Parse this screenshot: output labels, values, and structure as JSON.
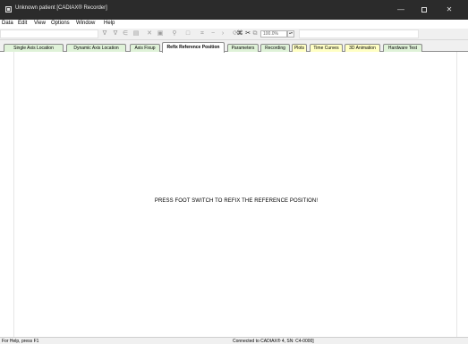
{
  "window": {
    "title": "Unknown patient [CADIAX® Recorder]",
    "minimize_glyph": "—",
    "close_glyph": "✕"
  },
  "menu": [
    "Data",
    "Edit",
    "View",
    "Options",
    "Window",
    "Help"
  ],
  "toolbar": {
    "zoom_value": "100.0%",
    "spin_glyph": "▴▾",
    "icons": [
      {
        "name": "filter-icon",
        "glyph": "∇"
      },
      {
        "name": "curve-select-icon",
        "glyph": "∇"
      },
      {
        "name": "transfer-icon",
        "glyph": "∈"
      },
      {
        "name": "print-icon",
        "glyph": "▤"
      },
      {
        "name": "delete-icon",
        "glyph": "✕"
      },
      {
        "name": "save-icon",
        "glyph": "▣"
      },
      {
        "name": "search-icon",
        "glyph": "⚲"
      },
      {
        "name": "copy-icon",
        "glyph": "□"
      },
      {
        "name": "grid-icon",
        "glyph": "⌗"
      },
      {
        "name": "minus-icon",
        "glyph": "−"
      },
      {
        "name": "arrow-right-icon",
        "glyph": "›"
      },
      {
        "name": "rotate-icon",
        "glyph": "⟳"
      },
      {
        "name": "scissors-icon",
        "glyph": "✂"
      },
      {
        "name": "trace-icon",
        "glyph": "⌘"
      },
      {
        "name": "settings-icon",
        "glyph": "⧉"
      }
    ]
  },
  "tabs": [
    {
      "label": "Single Axis Location",
      "bg": "#dff2d8",
      "active": false
    },
    {
      "label": "Dynamic Axis Location",
      "bg": "#dff2d8",
      "active": false
    },
    {
      "label": "Axis Fixup",
      "bg": "#dff2d8",
      "active": false
    },
    {
      "label": "Refix Reference Position",
      "bg": "#ffffff",
      "active": true
    },
    {
      "label": "Parameters",
      "bg": "#dff2d8",
      "active": false
    },
    {
      "label": "Recording",
      "bg": "#dff2d8",
      "active": false
    },
    {
      "label": "Plots",
      "bg": "#ffffc4",
      "active": false
    },
    {
      "label": "Time Curves",
      "bg": "#ffffc4",
      "active": false
    },
    {
      "label": "3D Animation",
      "bg": "#ffffc4",
      "active": false
    },
    {
      "label": "Hardware Test",
      "bg": "#dff2d8",
      "active": false
    }
  ],
  "main": {
    "message": "PRESS FOOT SWITCH TO REFIX THE REFERENCE POSITION!"
  },
  "status": {
    "help_text": "For Help, press F1",
    "connection": "Connected to CADIAX® 4, SN: C4-0000]"
  }
}
